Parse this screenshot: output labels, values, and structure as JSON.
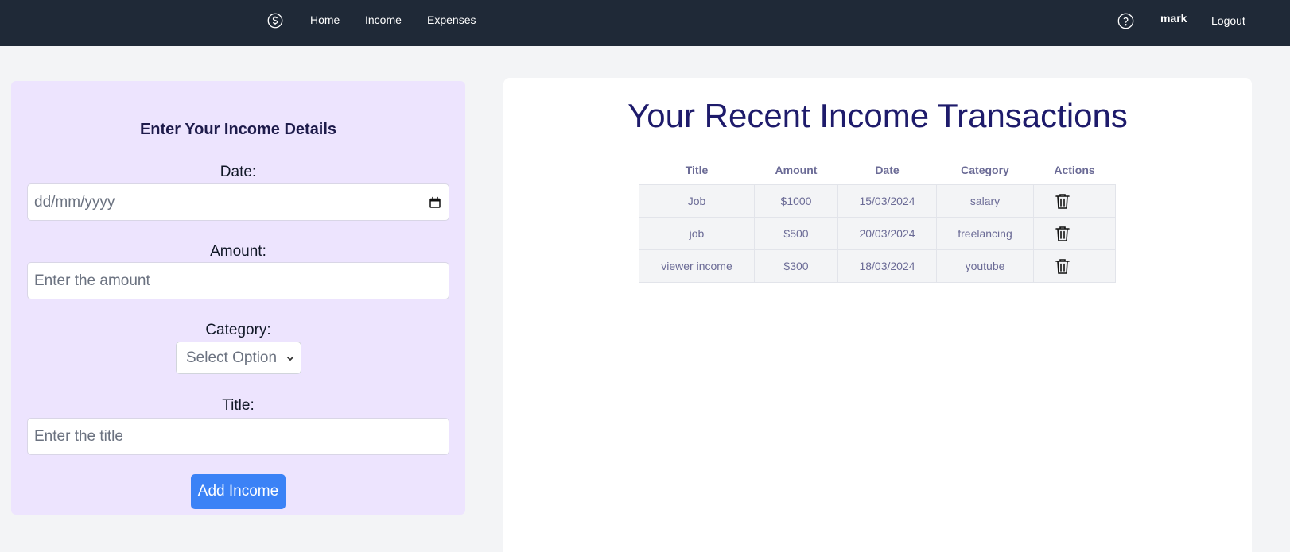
{
  "nav": {
    "logo_icon": "dollar-circle-icon",
    "links": [
      "Home",
      "Income",
      "Expenses"
    ],
    "help_icon": "question-circle-icon",
    "username": "mark",
    "logout": "Logout"
  },
  "form": {
    "title": "Enter Your Income Details",
    "date_label": "Date:",
    "date_placeholder": "dd/mm/yyyy",
    "amount_label": "Amount:",
    "amount_placeholder": "Enter the amount",
    "category_label": "Category:",
    "category_selected": "Select Option",
    "title_label": "Title:",
    "title_placeholder": "Enter the title",
    "submit_label": "Add Income"
  },
  "transactions": {
    "heading": "Your Recent Income Transactions",
    "columns": [
      "Title",
      "Amount",
      "Date",
      "Category",
      "Actions"
    ],
    "rows": [
      {
        "title": "Job",
        "amount": "$1000",
        "date": "15/03/2024",
        "category": "salary"
      },
      {
        "title": "job",
        "amount": "$500",
        "date": "20/03/2024",
        "category": "freelancing"
      },
      {
        "title": "viewer income",
        "amount": "$300",
        "date": "18/03/2024",
        "category": "youtube"
      }
    ],
    "action_icon": "trash-icon"
  },
  "colors": {
    "navbar": "#1f2937",
    "form_bg": "#ede4fe",
    "accent": "#3b82f6",
    "heading": "#1e1b6b"
  }
}
